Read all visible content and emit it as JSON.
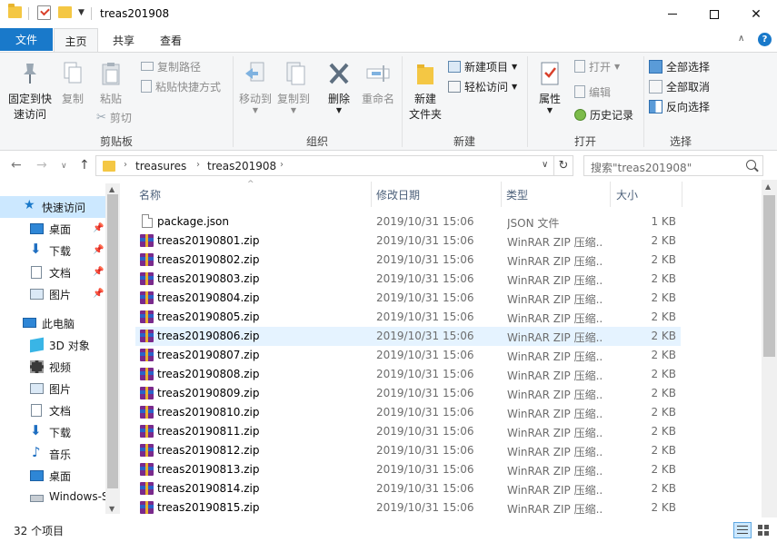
{
  "window": {
    "title": "treas201908",
    "minimize": "—",
    "maximize": "☐",
    "close": "✕"
  },
  "tabs": {
    "file": "文件",
    "home": "主页",
    "share": "共享",
    "view": "查看"
  },
  "ribbon": {
    "clipboard": {
      "label": "剪贴板",
      "pin_quick_access": "固定到快\n速访问",
      "copy": "复制",
      "paste": "粘贴",
      "copy_path": "复制路径",
      "paste_shortcut": "粘贴快捷方式",
      "cut": "剪切"
    },
    "organize": {
      "label": "组织",
      "move_to": "移动到",
      "copy_to": "复制到",
      "delete": "删除",
      "rename": "重命名"
    },
    "new": {
      "label": "新建",
      "new_folder": "新建\n文件夹",
      "new_item": "新建项目",
      "easy_access": "轻松访问"
    },
    "open": {
      "label": "打开",
      "properties": "属性",
      "open": "打开",
      "edit": "编辑",
      "history": "历史记录"
    },
    "select": {
      "label": "选择",
      "select_all": "全部选择",
      "select_none": "全部取消",
      "invert": "反向选择"
    }
  },
  "address": {
    "crumbs": [
      "treasures",
      "treas201908"
    ],
    "search_placeholder": "搜索\"treas201908\""
  },
  "nav": {
    "items": [
      {
        "label": "快速访问",
        "icon": "star-icon",
        "pinned": false,
        "selected": true
      },
      {
        "label": "桌面",
        "icon": "desktop-icon",
        "pinned": true
      },
      {
        "label": "下载",
        "icon": "download-icon",
        "pinned": true
      },
      {
        "label": "文档",
        "icon": "document-icon",
        "pinned": true
      },
      {
        "label": "图片",
        "icon": "picture-icon",
        "pinned": true
      },
      {
        "label": "此电脑",
        "icon": "computer-icon",
        "pinned": false
      },
      {
        "label": "3D 对象",
        "icon": "cube-icon",
        "pinned": false
      },
      {
        "label": "视频",
        "icon": "video-icon",
        "pinned": false
      },
      {
        "label": "图片",
        "icon": "picture-icon",
        "pinned": false
      },
      {
        "label": "文档",
        "icon": "document-icon",
        "pinned": false
      },
      {
        "label": "下载",
        "icon": "download-icon",
        "pinned": false
      },
      {
        "label": "音乐",
        "icon": "music-icon",
        "pinned": false
      },
      {
        "label": "桌面",
        "icon": "desktop-icon",
        "pinned": false
      },
      {
        "label": "Windows-S",
        "icon": "drive-icon",
        "pinned": false
      }
    ]
  },
  "list": {
    "headers": {
      "name": "名称",
      "date": "修改日期",
      "type": "类型",
      "size": "大小"
    },
    "rows": [
      {
        "name": "package.json",
        "date": "2019/10/31 15:06",
        "type": "JSON 文件",
        "size": "1 KB",
        "kind": "json"
      },
      {
        "name": "treas20190801.zip",
        "date": "2019/10/31 15:06",
        "type": "WinRAR ZIP 压缩...",
        "size": "2 KB",
        "kind": "zip"
      },
      {
        "name": "treas20190802.zip",
        "date": "2019/10/31 15:06",
        "type": "WinRAR ZIP 压缩...",
        "size": "2 KB",
        "kind": "zip"
      },
      {
        "name": "treas20190803.zip",
        "date": "2019/10/31 15:06",
        "type": "WinRAR ZIP 压缩...",
        "size": "2 KB",
        "kind": "zip"
      },
      {
        "name": "treas20190804.zip",
        "date": "2019/10/31 15:06",
        "type": "WinRAR ZIP 压缩...",
        "size": "2 KB",
        "kind": "zip"
      },
      {
        "name": "treas20190805.zip",
        "date": "2019/10/31 15:06",
        "type": "WinRAR ZIP 压缩...",
        "size": "2 KB",
        "kind": "zip"
      },
      {
        "name": "treas20190806.zip",
        "date": "2019/10/31 15:06",
        "type": "WinRAR ZIP 压缩...",
        "size": "2 KB",
        "kind": "zip",
        "hover": true
      },
      {
        "name": "treas20190807.zip",
        "date": "2019/10/31 15:06",
        "type": "WinRAR ZIP 压缩...",
        "size": "2 KB",
        "kind": "zip"
      },
      {
        "name": "treas20190808.zip",
        "date": "2019/10/31 15:06",
        "type": "WinRAR ZIP 压缩...",
        "size": "2 KB",
        "kind": "zip"
      },
      {
        "name": "treas20190809.zip",
        "date": "2019/10/31 15:06",
        "type": "WinRAR ZIP 压缩...",
        "size": "2 KB",
        "kind": "zip"
      },
      {
        "name": "treas20190810.zip",
        "date": "2019/10/31 15:06",
        "type": "WinRAR ZIP 压缩...",
        "size": "2 KB",
        "kind": "zip"
      },
      {
        "name": "treas20190811.zip",
        "date": "2019/10/31 15:06",
        "type": "WinRAR ZIP 压缩...",
        "size": "2 KB",
        "kind": "zip"
      },
      {
        "name": "treas20190812.zip",
        "date": "2019/10/31 15:06",
        "type": "WinRAR ZIP 压缩...",
        "size": "2 KB",
        "kind": "zip"
      },
      {
        "name": "treas20190813.zip",
        "date": "2019/10/31 15:06",
        "type": "WinRAR ZIP 压缩...",
        "size": "2 KB",
        "kind": "zip"
      },
      {
        "name": "treas20190814.zip",
        "date": "2019/10/31 15:06",
        "type": "WinRAR ZIP 压缩...",
        "size": "2 KB",
        "kind": "zip"
      },
      {
        "name": "treas20190815.zip",
        "date": "2019/10/31 15:06",
        "type": "WinRAR ZIP 压缩...",
        "size": "2 KB",
        "kind": "zip"
      }
    ]
  },
  "status": {
    "count": "32 个项目"
  },
  "colors": {
    "accent": "#1979ca",
    "selection": "#cce8ff",
    "hover": "#e5f3ff",
    "folder": "#f4c744"
  }
}
